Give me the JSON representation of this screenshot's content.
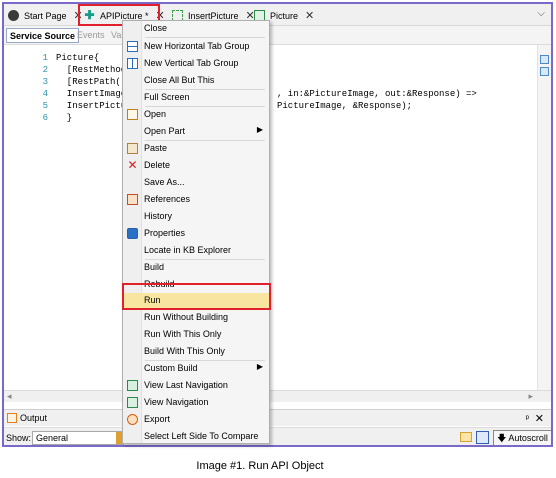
{
  "tabs": [
    {
      "label": "Start Page",
      "icon": "gx-logo-icon"
    },
    {
      "label": "APIPicture *",
      "icon": "api-object-icon"
    },
    {
      "label": "InsertPicture",
      "icon": "insert-procedure-icon"
    },
    {
      "label": "Picture",
      "icon": "transaction-icon"
    }
  ],
  "subtabs": {
    "active": "Service Source",
    "second": "Events",
    "third": "Vari"
  },
  "editor": {
    "line_numbers": [
      "1",
      "2",
      "3",
      "4",
      "5",
      "6"
    ],
    "lines": [
      "Picture{",
      "  [RestMethod",
      "  [RestPath(\"",
      "  InsertImage",
      "  InsertPictu",
      "  }"
    ],
    "line4_tail": ", in:&PictureImage, out:&Response) =>",
    "line5_tail": "PictureImage, &Response);"
  },
  "menu": {
    "items": [
      {
        "label": "Close",
        "icon": ""
      },
      {
        "label": "New Horizontal Tab Group",
        "icon": "horizontal-tab-group-icon"
      },
      {
        "label": "New Vertical Tab Group",
        "icon": "vertical-tab-group-icon"
      },
      {
        "label": "Close All But This",
        "icon": ""
      },
      {
        "label": "Full Screen",
        "icon": ""
      },
      {
        "label": "Open",
        "icon": "open-icon"
      },
      {
        "label": "Open Part",
        "icon": ""
      },
      {
        "label": "Paste",
        "icon": "paste-icon"
      },
      {
        "label": "Delete",
        "icon": "delete-icon"
      },
      {
        "label": "Save As...",
        "icon": ""
      },
      {
        "label": "References",
        "icon": "references-icon"
      },
      {
        "label": "History",
        "icon": ""
      },
      {
        "label": "Properties",
        "icon": "properties-icon"
      },
      {
        "label": "Locate in KB Explorer",
        "icon": ""
      },
      {
        "label": "Build",
        "icon": ""
      },
      {
        "label": "Rebuild",
        "icon": ""
      },
      {
        "label": "Run",
        "icon": ""
      },
      {
        "label": "Run Without Building",
        "icon": ""
      },
      {
        "label": "Run With This Only",
        "icon": ""
      },
      {
        "label": "Build With This Only",
        "icon": ""
      },
      {
        "label": "Custom Build",
        "icon": ""
      },
      {
        "label": "View Last Navigation",
        "icon": "navigation-icon"
      },
      {
        "label": "View Navigation",
        "icon": "navigation-icon"
      },
      {
        "label": "Export",
        "icon": "export-icon"
      },
      {
        "label": "Select Left Side To Compare",
        "icon": ""
      }
    ]
  },
  "output": {
    "title": "Output",
    "pin": "ᵖ",
    "show_label": "Show:",
    "show_value": "General",
    "autoscroll": "Autoscroll"
  },
  "caption": "Image #1. Run API Object",
  "colors": {
    "frame": "#7b68c8",
    "highlight": "#e0202a",
    "run_bg": "#f8e6a0"
  }
}
